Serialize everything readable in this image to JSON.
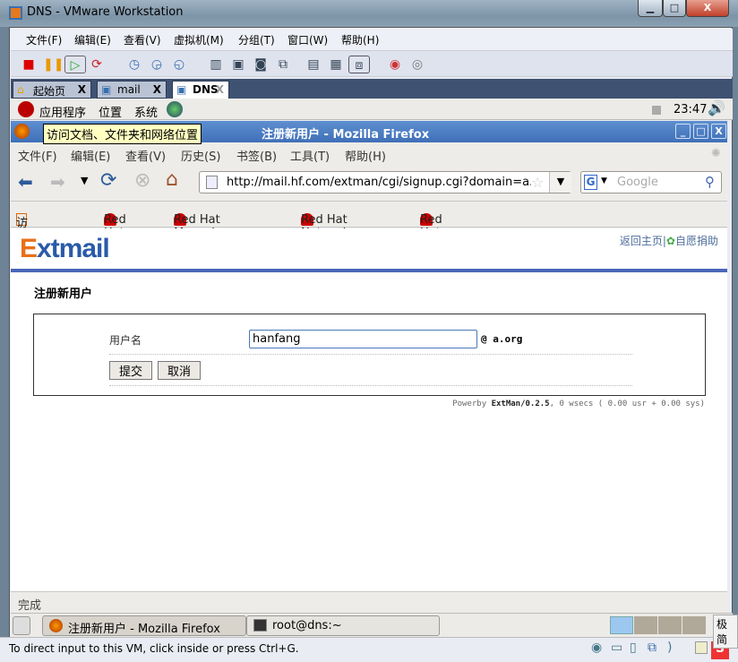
{
  "window": {
    "title": "DNS - VMware Workstation",
    "min": "▁",
    "max": "□",
    "close": "X"
  },
  "vm_menu": [
    "文件(F)",
    "编辑(E)",
    "查看(V)",
    "虚拟机(M)",
    "分组(T)",
    "窗口(W)",
    "帮助(H)"
  ],
  "vm_tabs": [
    {
      "label": "起始页",
      "close": "X"
    },
    {
      "label": "mail",
      "close": "X"
    },
    {
      "label": "DNS",
      "close": "X"
    }
  ],
  "gnome_panel": {
    "menus": [
      "应用程序",
      "位置",
      "系统"
    ],
    "clock": "23:47"
  },
  "tooltip": "访问文档、文件夹和网络位置",
  "firefox": {
    "title": "注册新用户 -  Mozilla Firefox",
    "menu": [
      "文件(F)",
      "编辑(E)",
      "查看(V)",
      "历史(S)",
      "书签(B)",
      "工具(T)",
      "帮助(H)"
    ],
    "url": "http://mail.hf.com/extman/cgi/signup.cgi?domain=a.",
    "search_placeholder": "Google",
    "bookmarks": [
      "访问最多▾",
      "Red Hat",
      "Red Hat Magazine",
      "Red Hat Network",
      "Red Hat Support"
    ],
    "status": "完成"
  },
  "page": {
    "logo": "Extmail",
    "links": {
      "home": "返回主页",
      "sep": "|",
      "donate": "自愿捐助"
    },
    "heading": "注册新用户",
    "form": {
      "username_label": "用户名",
      "username_value": "hanfang",
      "domain": "@ a.org",
      "submit": "提交",
      "cancel": "取消"
    },
    "footer": {
      "prefix": "Powerby ",
      "product": "ExtMan/0.2.5",
      "suffix": ", 0 wsecs ( 0.00 usr + 0.00 sys)"
    }
  },
  "taskbar": [
    {
      "label": "注册新用户 -  Mozilla Firefox"
    },
    {
      "label": "root@dns:~"
    }
  ],
  "ime_tip": "极简",
  "vm_status": "To direct input to this VM, click inside or press Ctrl+G.",
  "colors": {
    "accent_rule": "#4a66b8",
    "logo_orange": "#e8701a",
    "logo_blue": "#2a5aa8",
    "tab_bar": "#3f5272"
  }
}
